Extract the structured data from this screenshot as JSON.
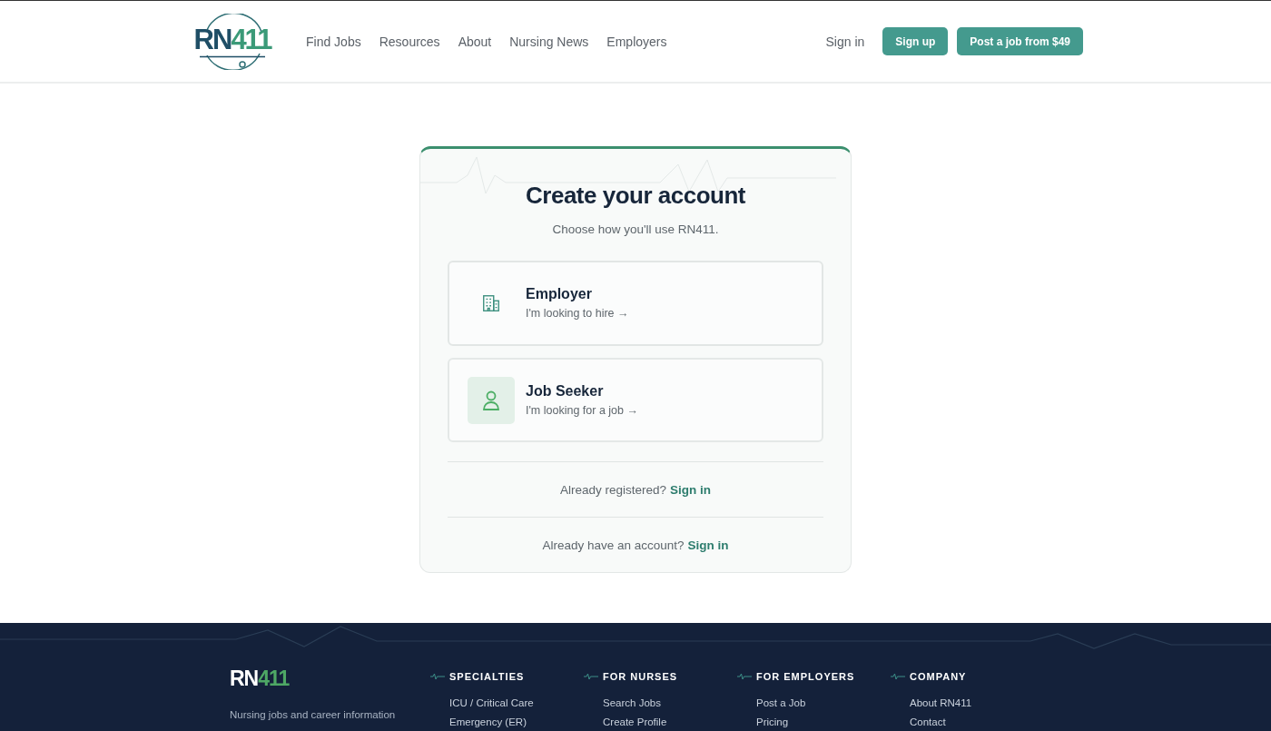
{
  "header": {
    "logo": {
      "text_primary": "RN",
      "text_accent": "411"
    },
    "nav": [
      "Find Jobs",
      "Resources",
      "About",
      "Nursing News",
      "Employers"
    ],
    "sign_in": "Sign in",
    "sign_up": "Sign up",
    "post_job": "Post a job from $49"
  },
  "card": {
    "title": "Create your account",
    "subtitle": "Choose how you'll use RN411.",
    "options": [
      {
        "kind": "employer",
        "title": "Employer",
        "description": "I'm looking to hire →",
        "selected": false
      },
      {
        "kind": "seeker",
        "title": "Job Seeker",
        "description": "I'm looking for a job →",
        "selected": true
      }
    ],
    "prompts": [
      {
        "text": "Already registered?",
        "link": "Sign in"
      },
      {
        "text": "Already have an account?",
        "link": "Sign in"
      }
    ]
  },
  "footer": {
    "logo": {
      "text_primary": "RN",
      "text_accent": "411"
    },
    "description": "Nursing jobs and career information",
    "columns": [
      {
        "heading": "SPECIALTIES",
        "links": [
          "ICU / Critical Care",
          "Emergency (ER)"
        ]
      },
      {
        "heading": "FOR NURSES",
        "links": [
          "Search Jobs",
          "Create Profile"
        ]
      },
      {
        "heading": "FOR EMPLOYERS",
        "links": [
          "Post a Job",
          "Pricing"
        ]
      },
      {
        "heading": "COMPANY",
        "links": [
          "About RN411",
          "Contact"
        ]
      }
    ]
  }
}
